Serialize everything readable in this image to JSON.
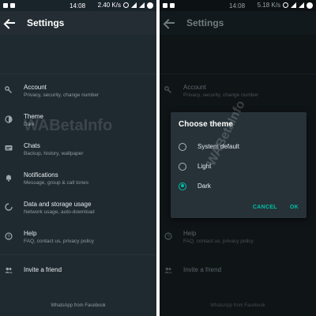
{
  "colors": {
    "accent": "#00bfa5",
    "background": "#1f2a30",
    "dialog": "#263238"
  },
  "left": {
    "status": {
      "time": "14:08",
      "speed": "2.40 K/s"
    },
    "header": {
      "title": "Settings"
    },
    "items": [
      {
        "title": "Account",
        "subtitle": "Privacy, security, change number",
        "icon": "key-icon"
      },
      {
        "title": "Theme",
        "subtitle": "Dark",
        "icon": "theme-icon"
      },
      {
        "title": "Chats",
        "subtitle": "Backup, history, wallpaper",
        "icon": "chat-icon"
      },
      {
        "title": "Notifications",
        "subtitle": "Message, group & call tones",
        "icon": "bell-icon"
      },
      {
        "title": "Data and storage usage",
        "subtitle": "Network usage, auto-download",
        "icon": "data-usage-icon"
      },
      {
        "title": "Help",
        "subtitle": "FAQ, contact us, privacy policy",
        "icon": "help-icon"
      },
      {
        "title": "Invite a friend",
        "subtitle": "",
        "icon": "people-icon"
      }
    ],
    "footer": "WhatsApp from Facebook",
    "watermark": "WABetaInfo"
  },
  "right": {
    "status": {
      "time": "14:08",
      "speed": "5.18 K/s"
    },
    "header": {
      "title": "Settings"
    },
    "items": [
      {
        "title": "Account",
        "subtitle": "Privacy, security, change number"
      },
      {
        "title": "Help",
        "subtitle": "FAQ, contact us, privacy policy"
      },
      {
        "title": "Invite a friend",
        "subtitle": ""
      }
    ],
    "footer": "WhatsApp from Facebook",
    "watermark": "WABetaInfo",
    "dialog": {
      "title": "Choose theme",
      "options": [
        {
          "label": "System default",
          "selected": false
        },
        {
          "label": "Light",
          "selected": false
        },
        {
          "label": "Dark",
          "selected": true
        }
      ],
      "cancel_label": "CANCEL",
      "ok_label": "OK"
    }
  }
}
